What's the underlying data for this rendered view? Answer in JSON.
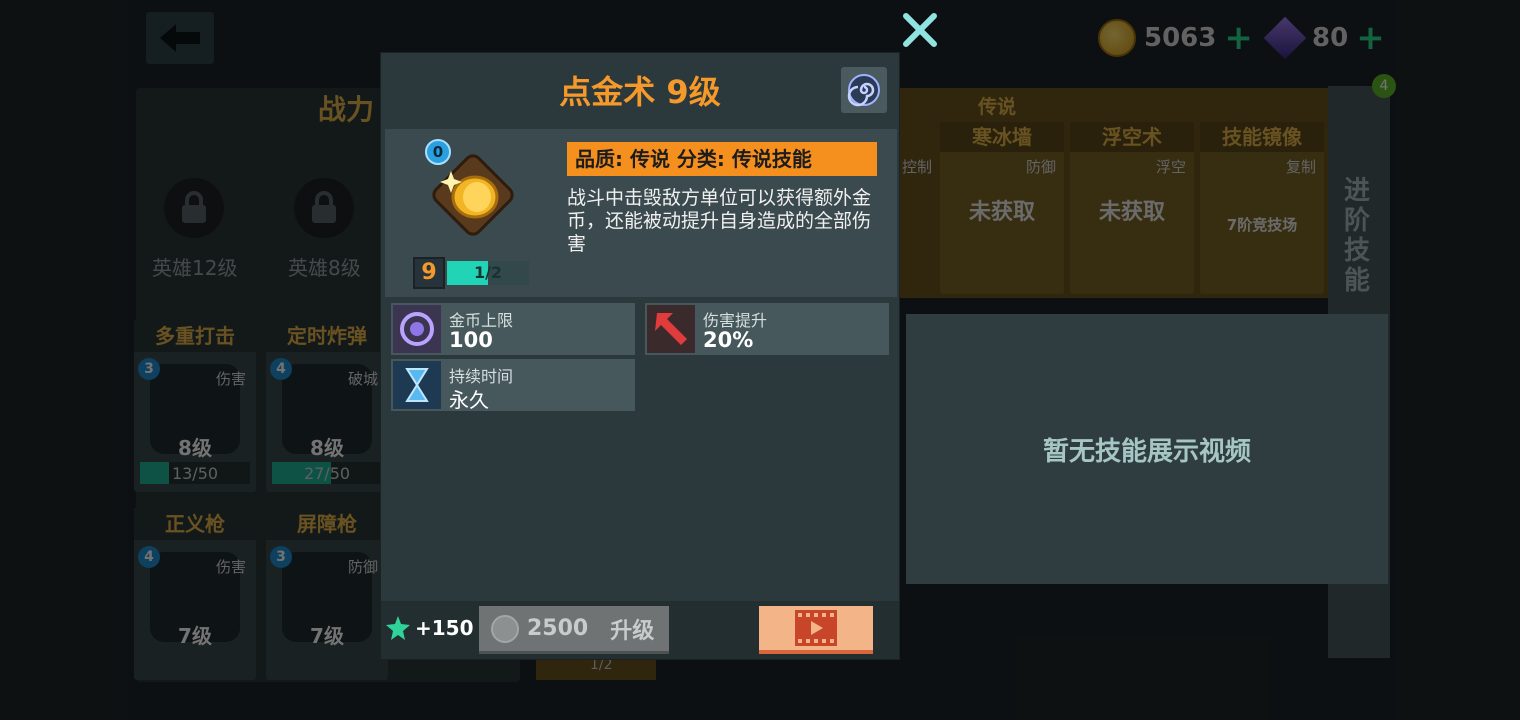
{
  "currency": {
    "gold_value": "5063",
    "gem_value": "80",
    "plus_symbol": "+"
  },
  "left_panel": {
    "title": "战力",
    "locked_slots": [
      {
        "label": "英雄12级"
      },
      {
        "label": "英雄8级"
      }
    ],
    "skills": [
      {
        "name": "多重打击",
        "rank": "3",
        "tag": "伤害",
        "level": "8级",
        "progress": "13/50",
        "progress_fraction": 0.26
      },
      {
        "name": "定时炸弹",
        "rank": "4",
        "tag": "破城",
        "level": "8级",
        "progress": "27/50",
        "progress_fraction": 0.54
      },
      {
        "name": "正义枪",
        "rank": "4",
        "tag": "伤害",
        "level": "7级"
      },
      {
        "name": "屏障枪",
        "rank": "3",
        "tag": "防御",
        "level": "7级"
      }
    ]
  },
  "right_panel": {
    "legend_header": "传说",
    "partial_tag": "控制",
    "cards": [
      {
        "name": "寒冰墙",
        "tag": "防御",
        "status": "未获取"
      },
      {
        "name": "浮空术",
        "tag": "浮空",
        "status": "未获取"
      },
      {
        "name": "技能镜像",
        "tag": "复制",
        "status": "7阶竞技场"
      }
    ],
    "advance_label": "进阶技能",
    "notification_count": "4",
    "below_progress": "1/2",
    "video_placeholder": "暂无技能展示视频"
  },
  "modal": {
    "title": "点金术 9级",
    "rank": "0",
    "level": "9",
    "progress_text": "1/2",
    "progress_fraction": 0.5,
    "quality_line": "品质: 传说   分类: 传说技能",
    "description": "战斗中击毁敌方单位可以获得额外金币，还能被动提升自身造成的全部伤害",
    "stats": [
      {
        "name": "金币上限",
        "value": "100",
        "icon": "coin-limit-icon"
      },
      {
        "name": "伤害提升",
        "value": "20%",
        "icon": "damage-up-icon"
      },
      {
        "name": "持续时间",
        "value": "永久",
        "icon": "hourglass-icon"
      }
    ],
    "footer": {
      "xp_gain": "+150",
      "upgrade_cost": "2500",
      "upgrade_label": "升级"
    }
  },
  "colors": {
    "accent_orange": "#f59a2a",
    "teal_progress": "#21d4b6",
    "gold_text": "#e8b64a"
  }
}
